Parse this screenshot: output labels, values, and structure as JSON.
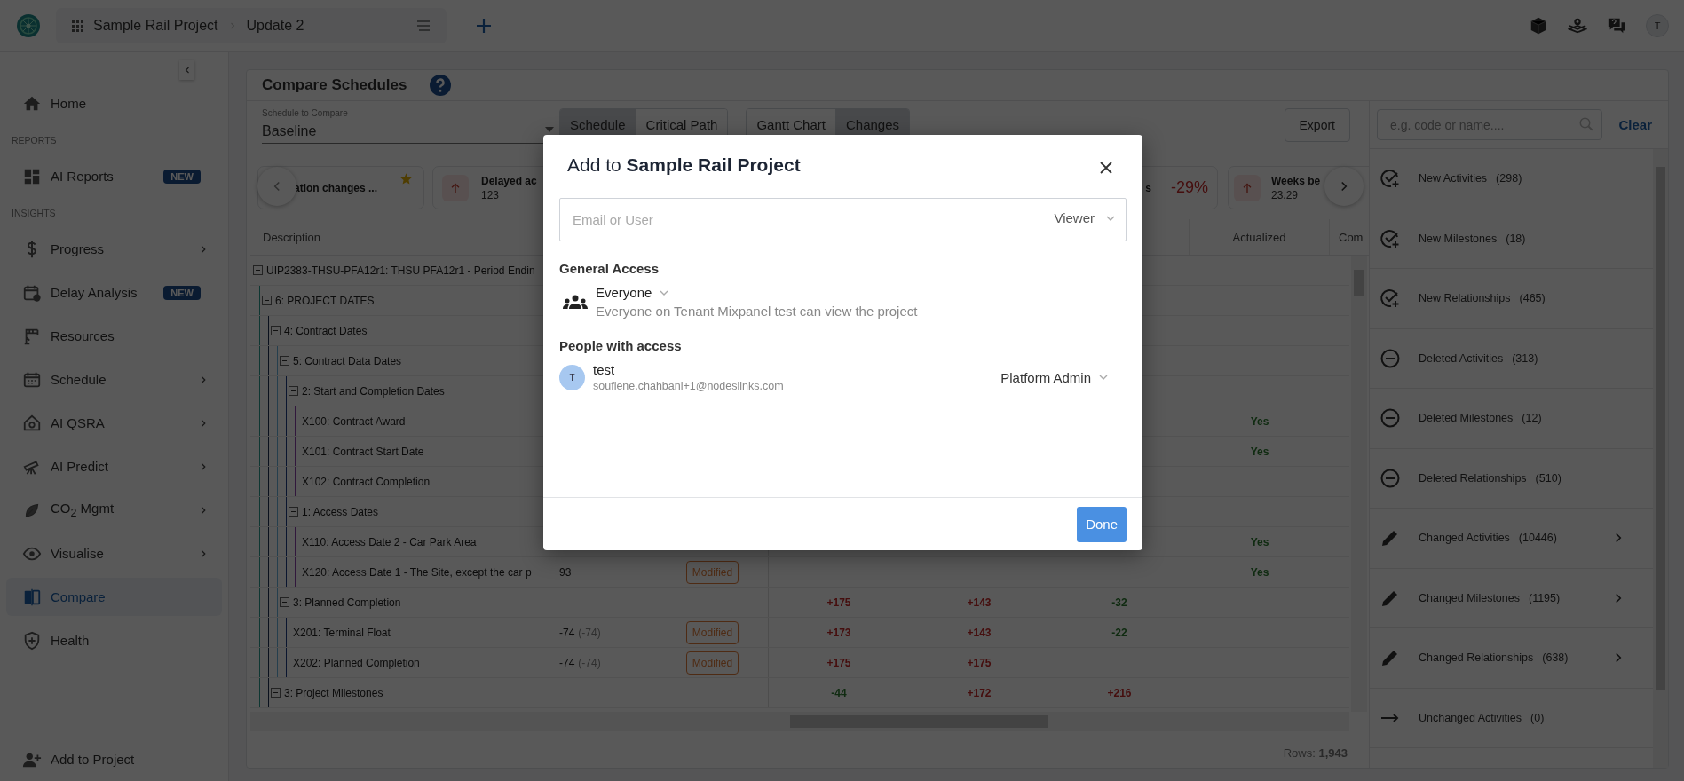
{
  "top_bar": {
    "breadcrumb": [
      "Sample Rail Project",
      "Update 2"
    ],
    "avatar": "T"
  },
  "sidebar": {
    "items": [
      {
        "kind": "item",
        "label": "Home",
        "selected": false,
        "expandable": false
      },
      {
        "kind": "section",
        "label": "REPORTS"
      },
      {
        "kind": "item",
        "label": "AI Reports",
        "badge": "NEW",
        "selected": false,
        "expandable": false
      },
      {
        "kind": "section",
        "label": "INSIGHTS"
      },
      {
        "kind": "item",
        "label": "Progress",
        "selected": false,
        "expandable": true
      },
      {
        "kind": "item",
        "label": "Delay Analysis",
        "badge": "NEW",
        "selected": false,
        "expandable": false
      },
      {
        "kind": "item",
        "label": "Resources",
        "selected": false,
        "expandable": false
      },
      {
        "kind": "item",
        "label": "Schedule",
        "selected": false,
        "expandable": true
      },
      {
        "kind": "item",
        "label": "AI QSRA",
        "selected": false,
        "expandable": true
      },
      {
        "kind": "item",
        "label": "AI Predict",
        "selected": false,
        "expandable": true
      },
      {
        "kind": "item",
        "label": "CO$_{2}$ Mgmt",
        "selected": false,
        "expandable": true
      },
      {
        "kind": "item",
        "label": "Visualise",
        "selected": false,
        "expandable": true
      },
      {
        "kind": "item",
        "label": "Compare",
        "selected": true,
        "expandable": false
      },
      {
        "kind": "item",
        "label": "Health",
        "selected": false,
        "expandable": false
      }
    ],
    "footer_item": {
      "label": "Add to Project"
    }
  },
  "page": {
    "title": "Compare Schedules",
    "compare_field": {
      "label": "Schedule to Compare",
      "value": "Baseline"
    },
    "tab_groups": [
      {
        "tabs": [
          {
            "label": "Schedule",
            "selected": true
          },
          {
            "label": "Critical Path",
            "selected": false
          }
        ]
      },
      {
        "tabs": [
          {
            "label": "Gantt Chart",
            "selected": false
          },
          {
            "label": "Changes",
            "selected": true
          }
        ]
      }
    ],
    "export": "Export",
    "kpi_cards": [
      {
        "kind": "plain",
        "title": "ation changes ...",
        "starred": true
      },
      {
        "kind": "arrow",
        "title": "Delayed ac",
        "value": "123",
        "starred": false
      },
      {
        "kind": "percent",
        "title": "s",
        "value": "-29%",
        "starred": false
      },
      {
        "kind": "arrow",
        "title": "Weeks be",
        "value": "23.29",
        "starred": false
      }
    ],
    "table": {
      "header": {
        "description": "Description",
        "actualized": "Actualized",
        "column_8": "Com"
      },
      "rows": [
        {
          "kind": "group",
          "description": "UIP2383-THSU-PFA12r1: THSU PFA12r1 - Period Endin",
          "expanded": true,
          "children": [
            {
              "kind": "group",
              "description": "6: PROJECT DATES",
              "expanded": true,
              "children": [
                {
                  "kind": "group",
                  "description": "4: Contract Dates",
                  "expanded": true,
                  "children": [
                    {
                      "kind": "group",
                      "description": "5: Contract Data Dates",
                      "expanded": true,
                      "children": [
                        {
                          "kind": "group",
                          "description": "2: Start and Completion Dates",
                          "expanded": true,
                          "children": [
                            {
                              "kind": "activity",
                              "description": "X100: Contract Award",
                              "actualized": "Yes"
                            },
                            {
                              "kind": "activity",
                              "description": "X101: Contract Start Date",
                              "actualized": "Yes"
                            },
                            {
                              "kind": "activity",
                              "description": "X102: Contract Completion"
                            }
                          ]
                        },
                        {
                          "kind": "group",
                          "description": "1: Access Dates",
                          "expanded": true,
                          "children": [
                            {
                              "kind": "activity",
                              "description": "X110: Access Date 2 - Car Park Area",
                              "actualized": "Yes"
                            },
                            {
                              "kind": "activity",
                              "description": "X120: Access Date 1 - The Site, except the car p",
                              "float": {
                                "value": "93"
                              },
                              "status": "Modified",
                              "actualized": "Yes"
                            }
                          ]
                        }
                      ]
                    },
                    {
                      "kind": "group",
                      "description": "3: Planned Completion",
                      "expanded": true,
                      "column_1": {
                        "text": "+175",
                        "late": true
                      },
                      "column_2": {
                        "text": "+143",
                        "late": true
                      },
                      "column_3": {
                        "text": "-32",
                        "late": false
                      },
                      "children": [
                        {
                          "kind": "activity",
                          "description": "X201: Terminal Float",
                          "float": {
                            "value": "-74",
                            "previous": "(-74)"
                          },
                          "status": "Modified",
                          "column_1": {
                            "text": "+173",
                            "late": true
                          },
                          "column_2": {
                            "text": "+143",
                            "late": true
                          },
                          "column_3": {
                            "text": "-22",
                            "late": false
                          }
                        },
                        {
                          "kind": "activity",
                          "description": "X202: Planned Completion",
                          "float": {
                            "value": "-74",
                            "previous": "(-74)"
                          },
                          "status": "Modified",
                          "column_1": {
                            "text": "+175",
                            "late": true
                          },
                          "column_2": {
                            "text": "+175",
                            "late": true
                          }
                        }
                      ]
                    }
                  ]
                },
                {
                  "kind": "group",
                  "description": "3: Project Milestones",
                  "expanded": true,
                  "column_1": {
                    "text": "-44",
                    "late": false
                  },
                  "column_2": {
                    "text": "+172",
                    "late": true
                  },
                  "column_3": {
                    "text": "+216",
                    "late": true
                  }
                }
              ]
            }
          ]
        }
      ],
      "row_count": "Rows: **1,943**"
    },
    "change_list": {
      "search": {
        "placeholder": "e.g. code or name...."
      },
      "clear": "Clear",
      "items": [
        {
          "kind": "new",
          "label": "New Activities",
          "count": "(298)",
          "expandable": false
        },
        {
          "kind": "new",
          "label": "New Milestones",
          "count": "(18)",
          "expandable": false
        },
        {
          "kind": "new",
          "label": "New Relationships",
          "count": "(465)",
          "expandable": false
        },
        {
          "kind": "deleted",
          "label": "Deleted Activities",
          "count": "(313)",
          "expandable": false
        },
        {
          "kind": "deleted",
          "label": "Deleted Milestones",
          "count": "(12)",
          "expandable": false
        },
        {
          "kind": "deleted",
          "label": "Deleted Relationships",
          "count": "(510)",
          "expandable": false
        },
        {
          "kind": "changed",
          "label": "Changed Activities",
          "count": "(10446)",
          "expandable": true
        },
        {
          "kind": "changed",
          "label": "Changed Milestones",
          "count": "(1195)",
          "expandable": true
        },
        {
          "kind": "changed",
          "label": "Changed Relationships",
          "count": "(638)",
          "expandable": true
        },
        {
          "kind": "unchanged",
          "label": "Unchanged Activities",
          "count": "(0)",
          "expandable": false
        }
      ]
    }
  },
  "dialog": {
    "title": "Add to **Sample Rail Project**",
    "invite": {
      "placeholder": "Email or User",
      "role": "Viewer"
    },
    "general_access": {
      "heading": "General Access",
      "option": "Everyone",
      "description": "Everyone on Tenant Mixpanel test can view the project"
    },
    "people": {
      "heading": "People with access",
      "members": [
        {
          "initial": "T",
          "name": "test",
          "email": "soufiene.chahbani+1@nodeslinks.com",
          "role": "Platform Admin"
        }
      ]
    },
    "done": "Done"
  }
}
